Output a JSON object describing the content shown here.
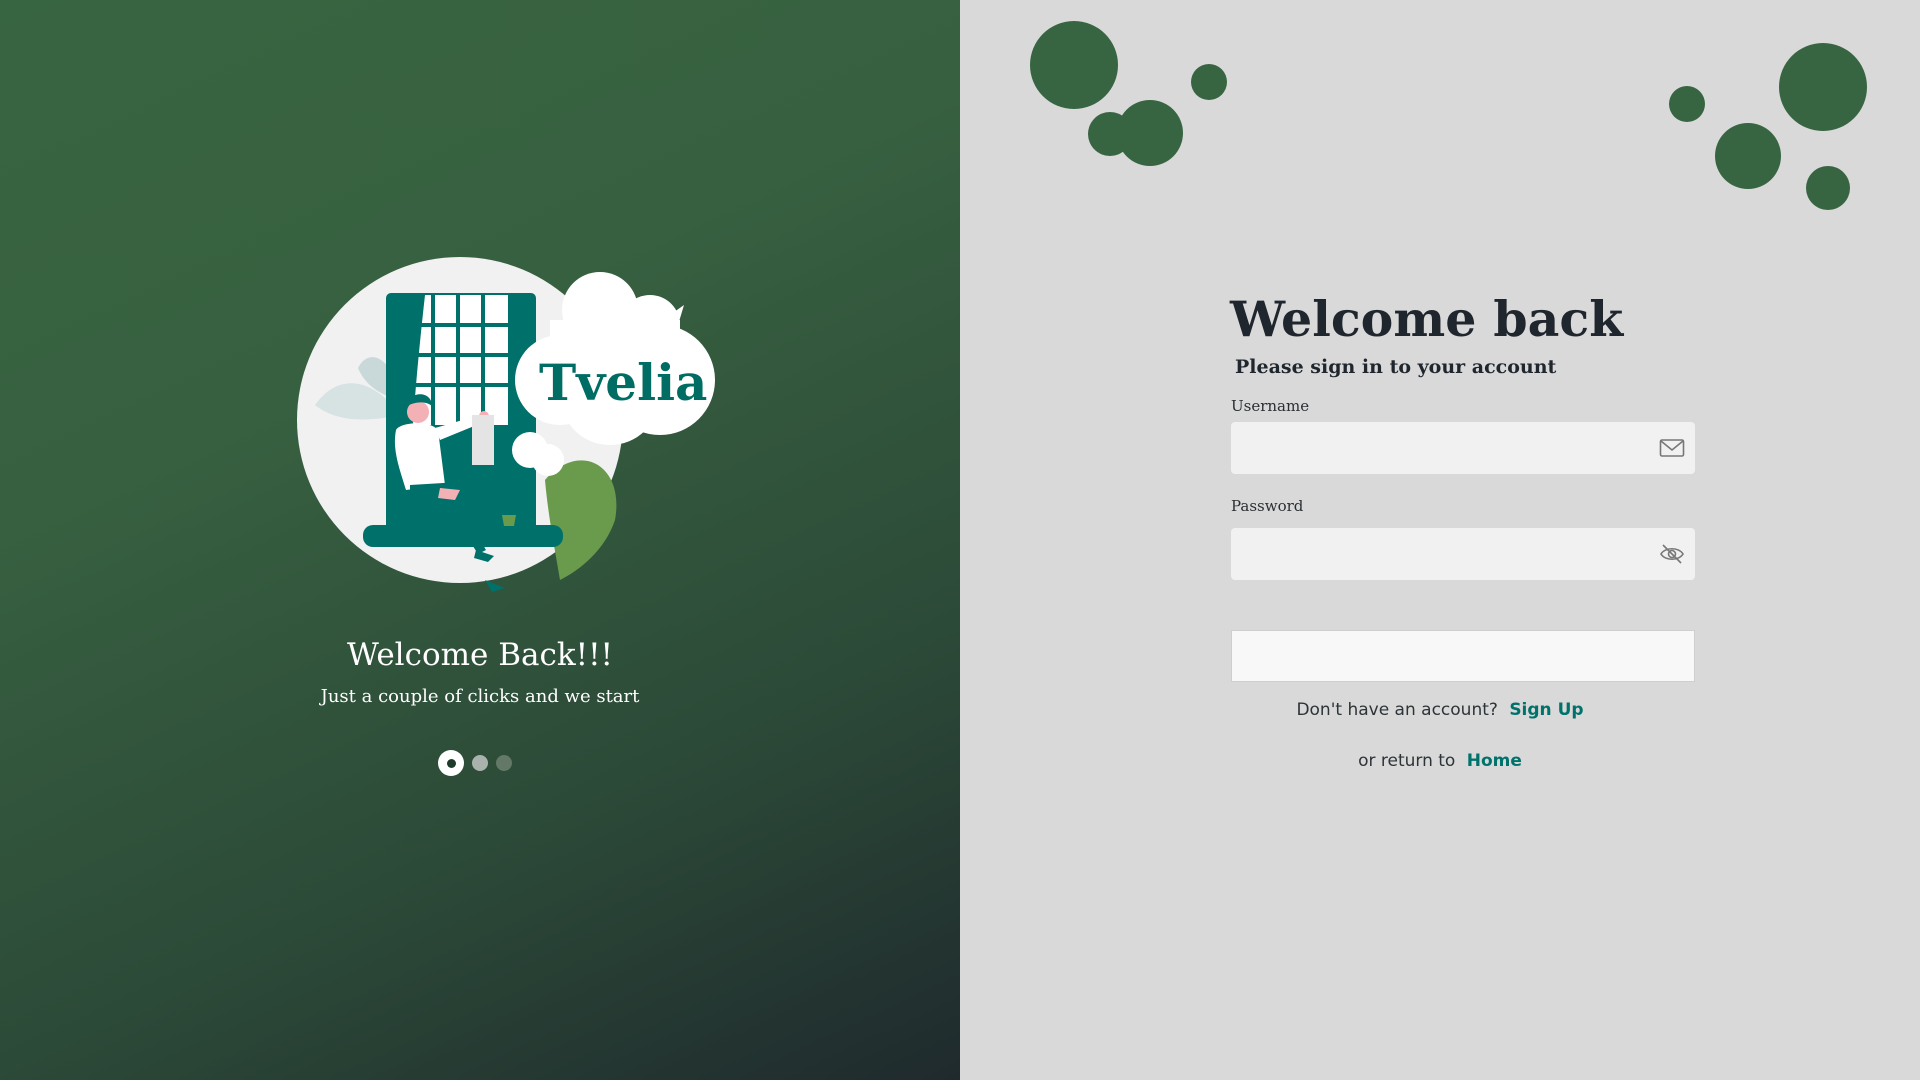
{
  "brand": {
    "name": "Tvelia"
  },
  "left": {
    "title": "Welcome Back!!!",
    "subtitle": "Just a couple of clicks and we start",
    "carousel": {
      "slide_count": 3,
      "active_index": 0
    }
  },
  "login": {
    "title": "Welcome back",
    "subtitle": "Please sign in to your account",
    "username": {
      "label": "Username",
      "value": "",
      "placeholder": "",
      "icon": "envelope-icon"
    },
    "password": {
      "label": "Password",
      "value": "",
      "placeholder": "",
      "icon": "eye-slash-icon"
    },
    "submit_label": "",
    "signup_prompt": "Don't have an account?",
    "signup_link": "Sign Up",
    "return_prompt": "or return to",
    "home_link": "Home"
  },
  "colors": {
    "primary_green": "#386541",
    "teal": "#006d65",
    "background_right": "#d9d9d9",
    "input_background": "#f2f1f1"
  }
}
